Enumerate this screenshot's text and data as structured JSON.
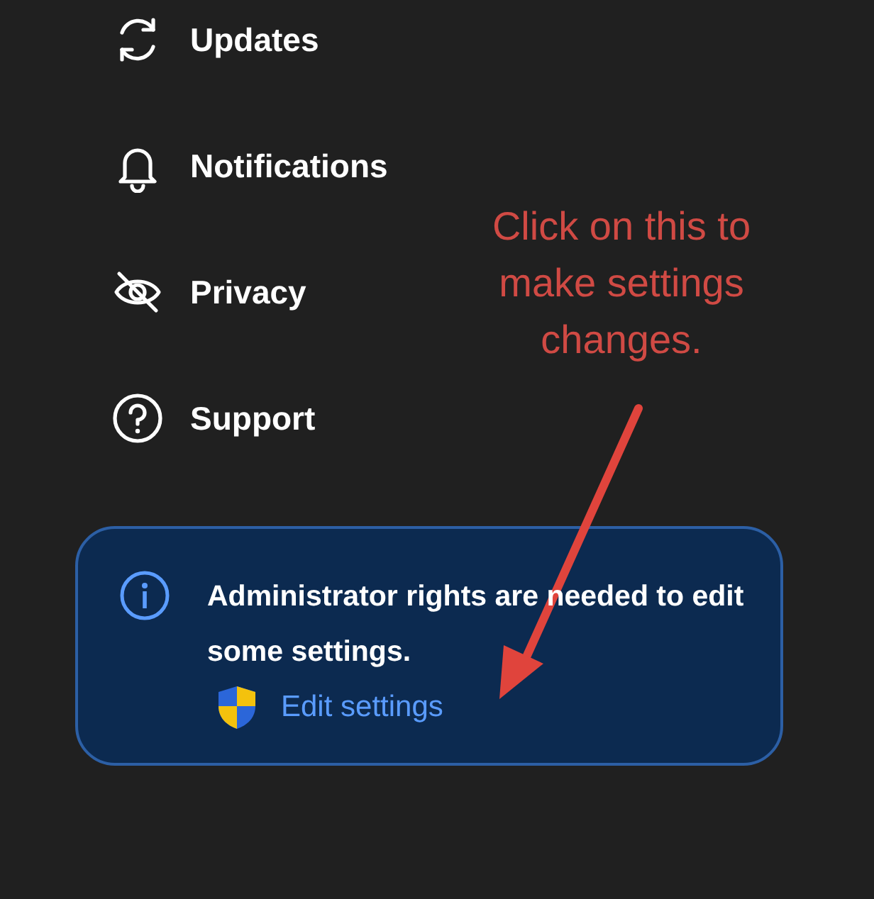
{
  "menu_items": [
    {
      "kind": "updates",
      "label": "Updates"
    },
    {
      "kind": "notifications",
      "label": "Notifications"
    },
    {
      "kind": "privacy",
      "label": "Privacy"
    },
    {
      "kind": "support",
      "label": "Support"
    }
  ],
  "notice": {
    "text": "Administrator rights are needed to edit some settings.",
    "link_label": "Edit settings"
  },
  "annotation": {
    "text": "Click on this to make settings changes."
  }
}
